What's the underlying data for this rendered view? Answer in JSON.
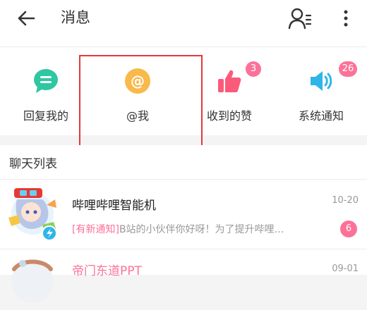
{
  "header": {
    "title": "消息"
  },
  "quick_actions": [
    {
      "label": "回复我的",
      "icon": "reply-bubble-icon",
      "color": "#2fc7a1"
    },
    {
      "label": "@我",
      "icon": "at-icon",
      "color": "#f9b94b"
    },
    {
      "label": "收到的赞",
      "icon": "thumbs-up-icon",
      "color": "#fb5b7a",
      "badge": "3"
    },
    {
      "label": "系统通知",
      "icon": "speaker-icon",
      "color": "#2fb5e9",
      "badge": "26"
    }
  ],
  "section": {
    "title": "聊天列表"
  },
  "conversations": [
    {
      "name": "哔哩哔哩智能机",
      "time": "10-20",
      "preview_tag": "[有新通知]",
      "preview_text": "B站的小伙伴你好呀！为了提升哔哩…",
      "unread": "6"
    },
    {
      "name": "帝门东道PPT",
      "time": "09-01"
    }
  ],
  "colors": {
    "accent_pink": "#fb7299",
    "highlight_border": "#e23a3a"
  }
}
